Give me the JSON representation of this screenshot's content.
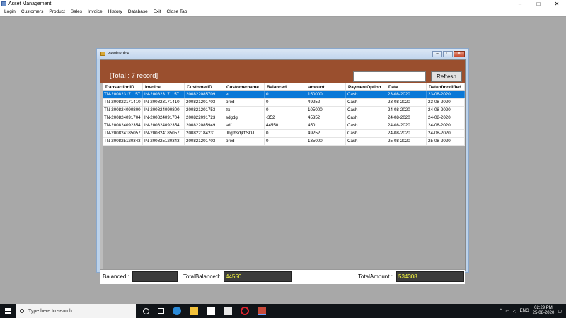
{
  "app": {
    "title": "Asset Management",
    "controls": [
      "–",
      "□",
      "✕"
    ]
  },
  "menu": [
    "Login",
    "Customers",
    "Product",
    "Sales",
    "Invoice",
    "History",
    "Database",
    "Exit",
    "Close Tab"
  ],
  "child": {
    "title": "viewinvoice",
    "controls": [
      "–",
      "□",
      "✕"
    ]
  },
  "header": {
    "total_text": "[Total : 7 record]",
    "search_value": "",
    "refresh_label": "Refresh"
  },
  "grid": {
    "columns": [
      "TransactionID",
      "Invoice",
      "CustomerID",
      "Customername",
      "Balanced",
      "amount",
      "PaymentOption",
      "Date",
      "Dateofmodified"
    ],
    "rows": [
      [
        "TN-200823171157",
        "IN-200823171157",
        "200822085709",
        "er",
        "0",
        "150000",
        "Cash",
        "23-08-2020",
        "23-08-2020"
      ],
      [
        "TN-200823171410",
        "IN-200823171410",
        "200821201703",
        "prod",
        "0",
        "49252",
        "Cash",
        "23-08-2020",
        "23-08-2020"
      ],
      [
        "TN-200824090800",
        "IN-200824090800",
        "200821201753",
        "zx",
        "0",
        "105000",
        "Cash",
        "24-08-2020",
        "24-08-2020"
      ],
      [
        "TN-200824091704",
        "IN-200824091704",
        "200822091723",
        "sdgdg",
        "-352",
        "45352",
        "Cash",
        "24-08-2020",
        "24-08-2020"
      ],
      [
        "TN-200824092354",
        "IN-200824092354",
        "200822085949",
        "sdf",
        "44550",
        "450",
        "Cash",
        "24-08-2020",
        "24-08-2020"
      ],
      [
        "TN-200824185057",
        "IN-200824185057",
        "200822184231",
        "Jkgfhsdjkf'SDJ",
        "0",
        "49252",
        "Cash",
        "24-08-2020",
        "24-08-2020"
      ],
      [
        "TN-200825120343",
        "IN-200825120343",
        "200821201703",
        "prod",
        "0",
        "135000",
        "Cash",
        "25-08-2020",
        "25-08-2020"
      ]
    ],
    "selected_row": 0
  },
  "footer": {
    "balanced_label": "Balanced :",
    "balanced_value": "",
    "total_balanced_label": "TotalBalanced:",
    "total_balanced_value": "44550",
    "total_amount_label": "TotalAmount :",
    "total_amount_value": "534308"
  },
  "taskbar": {
    "search_placeholder": "Type here to search",
    "language": "ENG",
    "time": "02:29 PM",
    "date": "25-08-2020"
  }
}
